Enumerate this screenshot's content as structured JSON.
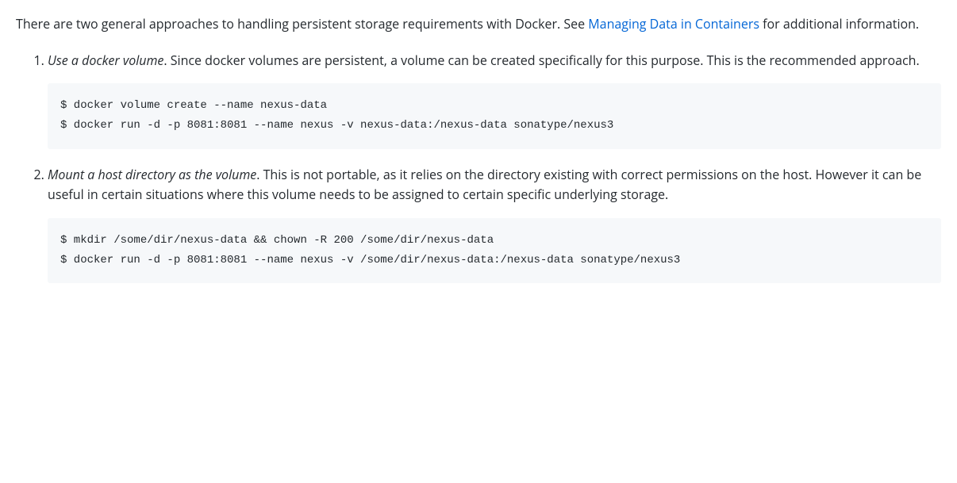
{
  "intro": {
    "text_before_link": "There are two general approaches to handling persistent storage requirements with Docker. See ",
    "link_text": "Managing Data in Containers",
    "text_after_link": " for additional information."
  },
  "items": [
    {
      "emphasis": "Use a docker volume",
      "rest": ". Since docker volumes are persistent, a volume can be created specifically for this purpose. This is the recommended approach.",
      "code": "$ docker volume create --name nexus-data\n$ docker run -d -p 8081:8081 --name nexus -v nexus-data:/nexus-data sonatype/nexus3"
    },
    {
      "emphasis": "Mount a host directory as the volume",
      "rest": ". This is not portable, as it relies on the directory existing with correct permissions on the host. However it can be useful in certain situations where this volume needs to be assigned to certain specific underlying storage.",
      "code": "$ mkdir /some/dir/nexus-data && chown -R 200 /some/dir/nexus-data\n$ docker run -d -p 8081:8081 --name nexus -v /some/dir/nexus-data:/nexus-data sonatype/nexus3"
    }
  ]
}
